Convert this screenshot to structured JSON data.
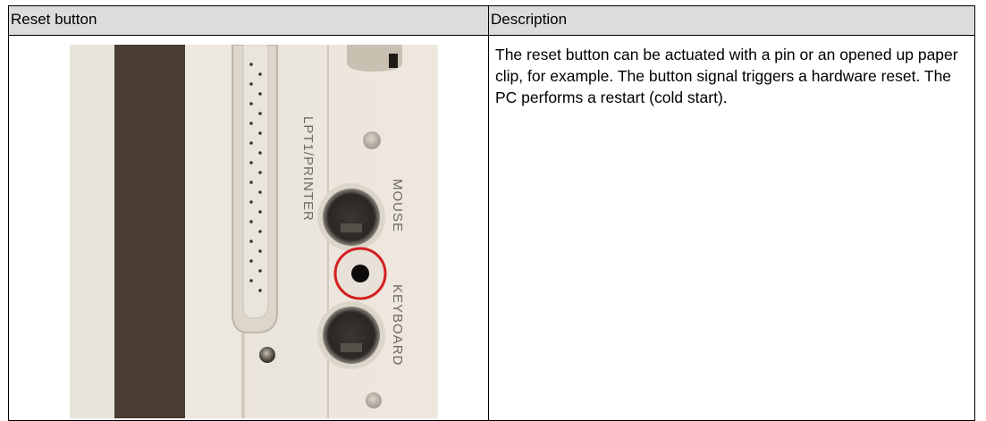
{
  "table": {
    "header_col1": "Reset button",
    "header_col2": "Description",
    "description": "The reset button can be actuated with a pin or an opened up paper clip, for example. The button signal triggers a hardware reset. The PC performs a restart (cold start)."
  },
  "photo": {
    "label_printer": "LPT1/PRINTER",
    "label_mouse": "MOUSE",
    "label_keyboard": "KEYBOARD",
    "highlight_color": "#d42020"
  }
}
